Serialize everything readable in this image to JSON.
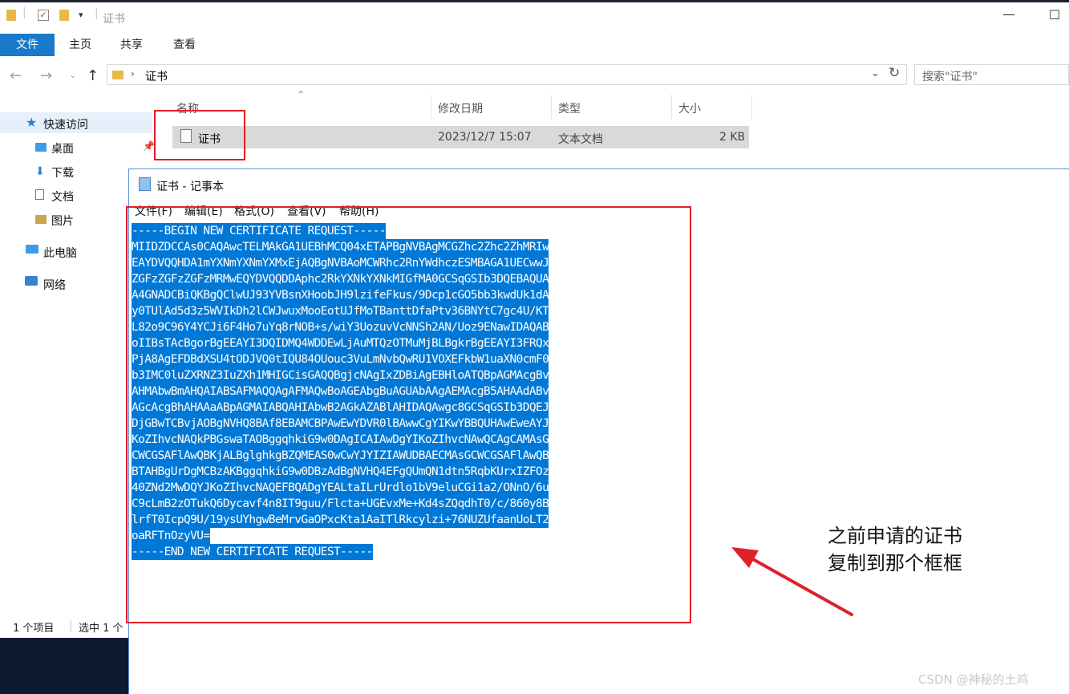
{
  "explorer": {
    "title": "证书",
    "ribbon_tabs": {
      "file": "文件",
      "home": "主页",
      "share": "共享",
      "view": "查看"
    },
    "address": {
      "path": "证书",
      "search_placeholder": "搜索\"证书\""
    },
    "sidebar": {
      "quick_access": "快速访问",
      "desktop": "桌面",
      "downloads": "下载",
      "documents": "文档",
      "pictures": "图片",
      "this_pc": "此电脑",
      "network": "网络"
    },
    "columns": {
      "name": "名称",
      "modified": "修改日期",
      "type": "类型",
      "size": "大小"
    },
    "file": {
      "name": "证书",
      "modified": "2023/12/7 15:07",
      "type": "文本文档",
      "size": "2 KB"
    },
    "status": {
      "count": "1 个项目",
      "selected": "选中 1 个"
    }
  },
  "notepad": {
    "title": "证书 - 记事本",
    "menu": [
      "文件(F)",
      "编辑(E)",
      "格式(O)",
      "查看(V)",
      "帮助(H)"
    ],
    "lines": [
      "-----BEGIN NEW CERTIFICATE REQUEST-----",
      "MIIDZDCCAs0CAQAwcTELMAkGA1UEBhMCQ04xETAPBgNVBAgMCGZhc2Zhc2ZhMRIw",
      "EAYDVQQHDA1mYXNmYXNmYXMxEjAQBgNVBAoMCWRhc2RnYWdhczESMBAGA1UECwwJ",
      "ZGFzZGFzZGFzMRMwEQYDVQQDDAphc2RkYXNkYXNkMIGfMA0GCSqGSIb3DQEBAQUA",
      "A4GNADCBiQKBgQClwUJ93YVBsnXHoobJH9lzifeFkus/9Dcp1cGO5bb3kwdUk1dA",
      "y0TUlAd5d3z5WVIkDh2lCWJwuxMooEotUJfMoTBanttDfaPtv36BNYtC7gc4U/KT",
      "L82o9C96Y4YCJi6F4Ho7uYq8rNOB+s/wiY3UozuvVcNNSh2AN/Uoz9ENawIDAQAB",
      "oIIBsTAcBgorBgEEAYI3DQIDMQ4WDDEwLjAuMTQzOTMuMjBLBgkrBgEEAYI3FRQx",
      "PjA8AgEFDBdXSU4tODJVQ0tIQU84OUouc3VuLmNvbQwRU1VOXEFkbW1uaXN0cmF0",
      "b3IMC0luZXRNZ3IuZXh1MHIGCisGAQQBgjcNAgIxZDBiAgEBHloATQBpAGMAcgBv",
      "AHMAbwBmAHQAIABSAFMAQQAgAFMAQwBoAGEAbgBuAGUAbAAgAEMAcgB5AHAAdABv",
      "AGcAcgBhAHAAaABpAGMAIABQAHIAbwB2AGkAZABlAHIDAQAwgc8GCSqGSIb3DQEJ",
      "DjGBwTCBvjAOBgNVHQ8BAf8EBAMCBPAwEwYDVR0lBAwwCgYIKwYBBQUHAwEweAYJ",
      "KoZIhvcNAQkPBGswaTAOBggqhkiG9w0DAgICAIAwDgYIKoZIhvcNAwQCAgCAMAsG",
      "CWCGSAFlAwQBKjALBglghkgBZQMEAS0wCwYJYIZIAWUDBAECMAsGCWCGSAFlAwQB",
      "BTAHBgUrDgMCBzAKBggqhkiG9w0DBzAdBgNVHQ4EFgQUmQN1dtn5RqbKUrxIZFOz",
      "40ZNd2MwDQYJKoZIhvcNAQEFBQADgYEALtaILrUrdlo1bV9eluCGi1a2/ONnO/6u",
      "C9cLmB2zOTukQ6Dycavf4n8IT9guu/Flcta+UGEvxMe+Kd4sZQqdhT0/c/860y8B",
      "lrfT0IcpQ9U/19ysUYhgwBeMrvGaOPxcKta1AaITlRkcylzi+76NUZUfaanUoLT2",
      "oaRFTnOzyVU=",
      "-----END NEW CERTIFICATE REQUEST-----"
    ]
  },
  "annotation": {
    "line1": "之前申请的证书",
    "line2": "复制到那个框框"
  },
  "watermark": "CSDN @神秘的土鸡"
}
